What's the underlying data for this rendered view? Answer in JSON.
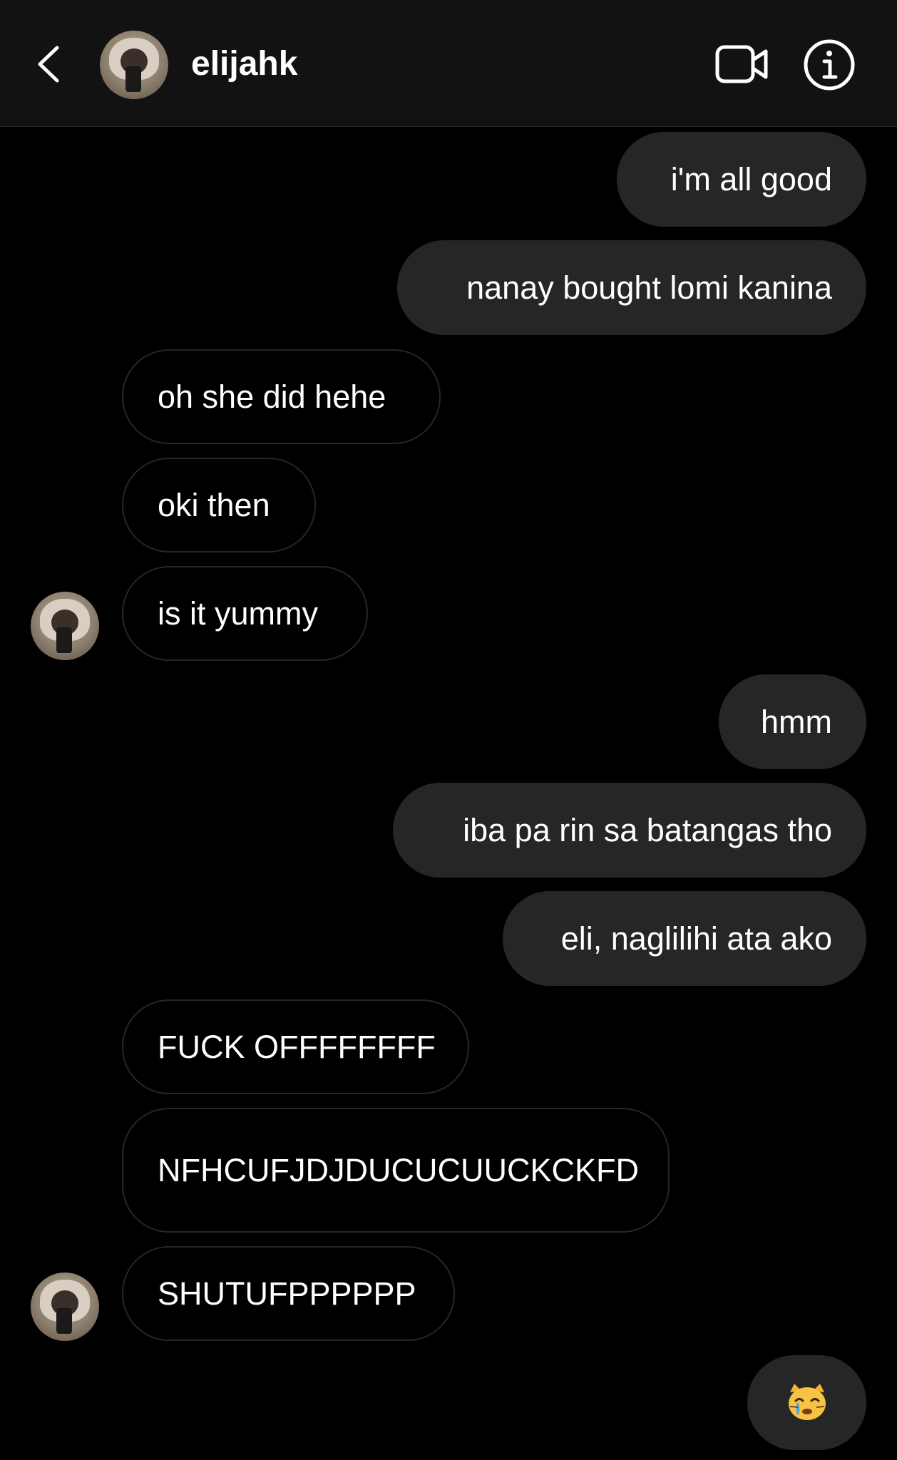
{
  "header": {
    "username": "elijahk"
  },
  "messages": [
    {
      "side": "out",
      "text": "i'm all good"
    },
    {
      "side": "out",
      "text": "nanay bought lomi kanina"
    },
    {
      "side": "in",
      "text": "oh she did hehe"
    },
    {
      "side": "in",
      "text": "oki then"
    },
    {
      "side": "in",
      "text": "is it yummy"
    },
    {
      "side": "out",
      "text": "hmm"
    },
    {
      "side": "out",
      "text": "iba pa rin sa batangas tho"
    },
    {
      "side": "out",
      "text": "eli, naglilihi ata ako"
    },
    {
      "side": "in",
      "text": "FUCK OFFFFFFFF"
    },
    {
      "side": "in",
      "text": "NFHCUFJDJDUCUCUUCKCKFD"
    },
    {
      "side": "in",
      "text": "SHUTUFPPPPPP"
    },
    {
      "side": "out",
      "text": "",
      "emoji": "crying-cat-face"
    }
  ],
  "colors": {
    "background": "#000000",
    "header": "#121212",
    "outgoing_bubble": "#262626",
    "incoming_border": "#262626",
    "text": "#ffffff"
  }
}
